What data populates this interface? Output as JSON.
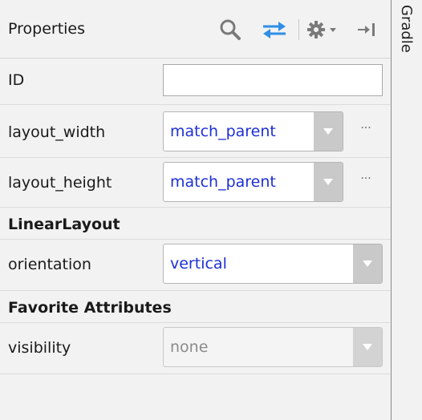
{
  "panel": {
    "title": "Properties"
  },
  "sidebar": {
    "tab_label": "Gradle"
  },
  "toolbar": {
    "icons": [
      "search-icon",
      "swap-arrows-icon",
      "gear-icon",
      "chevron-down-icon",
      "hide-panel-icon"
    ]
  },
  "colors": {
    "value_blue": "#1d2fd6",
    "swap_icon_blue": "#2f8fe6",
    "disabled_text": "#8a8a8a"
  },
  "fields": {
    "id": {
      "label": "ID",
      "value": ""
    },
    "layout_width": {
      "label": "layout_width",
      "value": "match_parent",
      "more": "···"
    },
    "layout_height": {
      "label": "layout_height",
      "value": "match_parent",
      "more": "···"
    }
  },
  "sections": {
    "linear_layout": {
      "title": "LinearLayout",
      "orientation": {
        "label": "orientation",
        "value": "vertical"
      }
    },
    "favorite_attributes": {
      "title": "Favorite Attributes",
      "visibility": {
        "label": "visibility",
        "value": "none"
      }
    }
  }
}
